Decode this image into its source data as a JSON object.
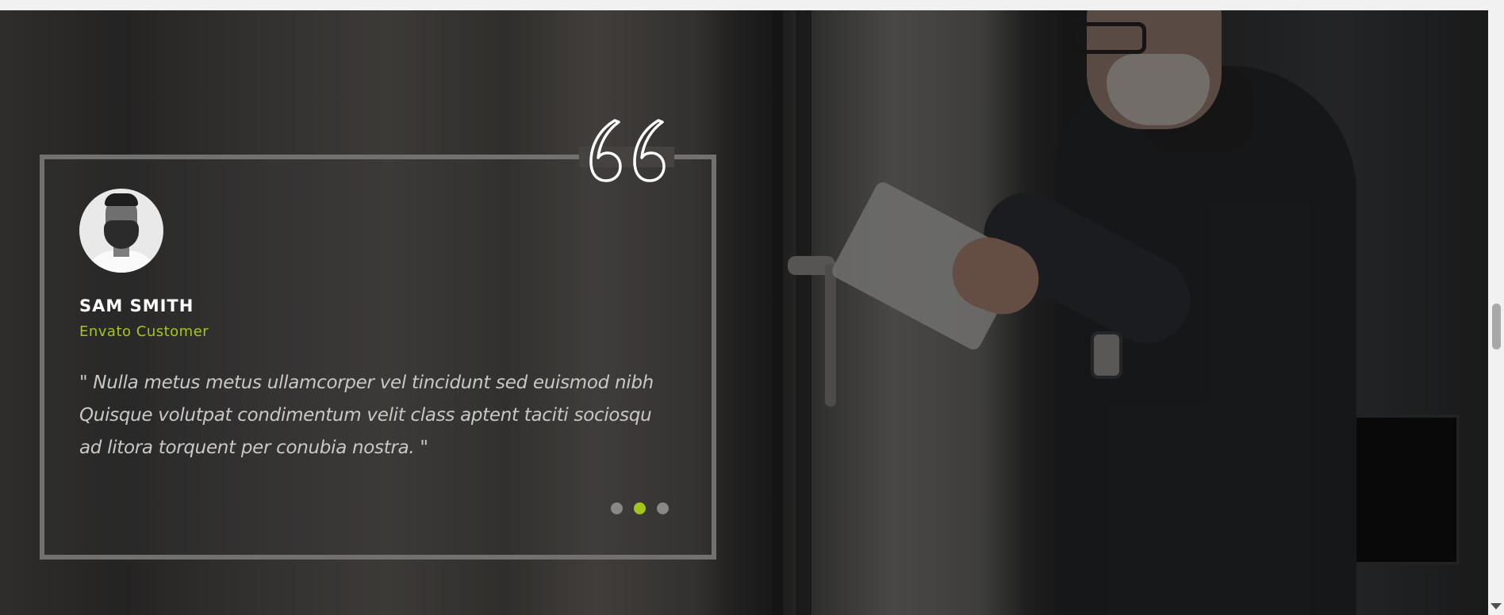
{
  "testimonial": {
    "name": "SAM SMITH",
    "role": "Envato Customer",
    "quote": "\" Nulla metus metus ullamcorper vel tincidunt sed euismod nibh Quisque volutpat condimentum velit class aptent taciti sociosqu ad litora torquent per conubia nostra. \"",
    "quote_icon": "quote-open-icon",
    "avatar_icon": "avatar"
  },
  "slider": {
    "slide_count": 3,
    "active_index": 1
  },
  "colors": {
    "accent": "#a3c61c",
    "dot_inactive": "#8a8886",
    "card_border": "#737170",
    "text": "#ffffff",
    "quote_text": "#c9c8c6"
  }
}
